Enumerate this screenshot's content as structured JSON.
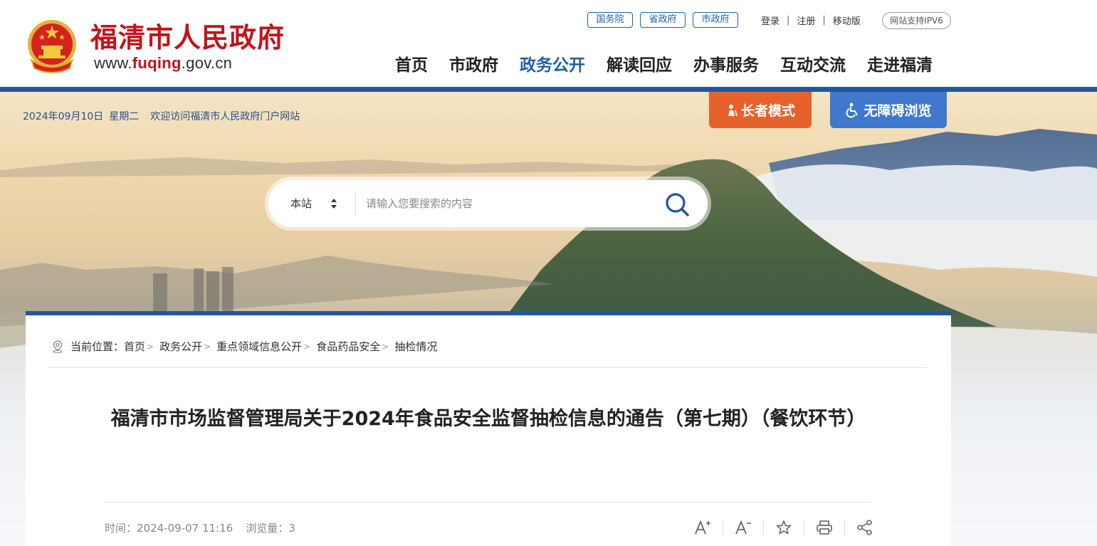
{
  "header": {
    "site_title": "福清市人民政府",
    "domain_prefix": "www.",
    "domain_highlight": "fuqing",
    "domain_suffix": ".gov.cn",
    "gov_links": [
      "国务院",
      "省政府",
      "市政府"
    ],
    "user_links": [
      "登录",
      "注册",
      "移动版"
    ],
    "ipv6_badge": "网站支持IPV6",
    "nav": [
      "首页",
      "市政府",
      "政务公开",
      "解读回应",
      "办事服务",
      "互动交流",
      "走进福清"
    ],
    "active_nav": "政务公开"
  },
  "banner": {
    "date": "2024年09月10日",
    "weekday": "星期二",
    "welcome": "欢迎访问福清市人民政府门户网站",
    "elder_mode": "长者模式",
    "accessibility": "无障碍浏览"
  },
  "search": {
    "scope": "本站",
    "placeholder": "请输入您要搜索的内容"
  },
  "breadcrumb": {
    "label": "当前位置：",
    "items": [
      "首页",
      "政务公开",
      "重点领域信息公开",
      "食品药品安全",
      "抽检情况"
    ]
  },
  "article": {
    "title": "福清市市场监督管理局关于2024年食品安全监督抽检信息的通告（第七期）（餐饮环节）",
    "time_label": "时间：",
    "time": "2024-09-07 11:16",
    "views_label": "浏览量：",
    "views": "3"
  },
  "tools": [
    "A+",
    "A-",
    "star-icon",
    "print-icon",
    "share-icon"
  ],
  "colors": {
    "brand_red": "#c3131b",
    "brand_blue": "#1f57a0",
    "elder_orange": "#e7622a",
    "access_blue": "#3f78cc"
  }
}
